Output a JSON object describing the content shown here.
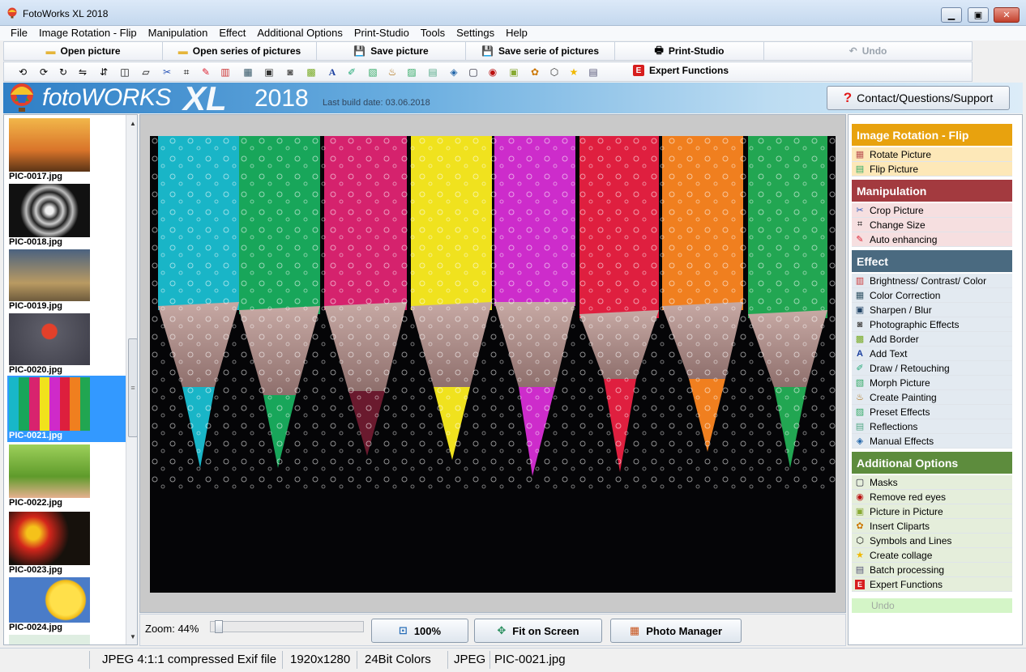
{
  "window": {
    "title": "FotoWorks XL 2018"
  },
  "menu": [
    "File",
    "Image Rotation - Flip",
    "Manipulation",
    "Effect",
    "Additional Options",
    "Print-Studio",
    "Tools",
    "Settings",
    "Help"
  ],
  "toolbar": {
    "open_picture": "Open picture",
    "open_series": "Open series of pictures",
    "save_picture": "Save picture",
    "save_serie": "Save serie of pictures",
    "print_studio": "Print-Studio",
    "undo": "Undo",
    "expert": "Expert Functions"
  },
  "banner": {
    "logo": "fotoWORKS",
    "logo_xl": "XL",
    "year": "2018",
    "build": "Last build date: 03.06.2018",
    "contact": "Contact/Questions/Support"
  },
  "thumbnails": [
    {
      "name": "PIC-0017.jpg",
      "selected": false
    },
    {
      "name": "PIC-0018.jpg",
      "selected": false
    },
    {
      "name": "PIC-0019.jpg",
      "selected": false
    },
    {
      "name": "PIC-0020.jpg",
      "selected": false
    },
    {
      "name": "PIC-0021.jpg",
      "selected": true
    },
    {
      "name": "PIC-0022.jpg",
      "selected": false
    },
    {
      "name": "PIC-0023.jpg",
      "selected": false
    },
    {
      "name": "PIC-0024.jpg",
      "selected": false
    }
  ],
  "viewer": {
    "zoom_label": "Zoom: 44%",
    "zoom_level": 0.03
  },
  "bottom_buttons": {
    "hundred": "100%",
    "fit": "Fit on Screen",
    "manager": "Photo Manager"
  },
  "tasks": {
    "rotation": {
      "title": "Image Rotation - Flip",
      "color": "#e8a20e",
      "items": [
        "Rotate Picture",
        "Flip Picture"
      ]
    },
    "manipulation": {
      "title": "Manipulation",
      "color": "#a33a3f",
      "items": [
        "Crop Picture",
        "Change Size",
        "Auto enhancing"
      ]
    },
    "effect": {
      "title": "Effect",
      "color": "#4a6a80",
      "items": [
        "Brightness/ Contrast/ Color",
        "Color Correction",
        "Sharpen / Blur",
        "Photographic Effects",
        "Add Border",
        "Add Text",
        "Draw / Retouching",
        "Morph Picture",
        "Create Painting",
        "Preset Effects",
        "Reflections",
        "Manual Effects"
      ]
    },
    "additional": {
      "title": "Additional Options",
      "color": "#5d8c3d",
      "items": [
        "Masks",
        "Remove red eyes",
        "Picture in Picture",
        "Insert Cliparts",
        "Symbols and Lines",
        "Create collage",
        "Batch processing",
        "Expert Functions"
      ]
    },
    "undo": "Undo"
  },
  "status": {
    "format": "JPEG 4:1:1 compressed Exif file",
    "dimensions": "1920x1280",
    "colors": "24Bit Colors",
    "type": "JPEG",
    "file": "PIC-0021.jpg"
  }
}
